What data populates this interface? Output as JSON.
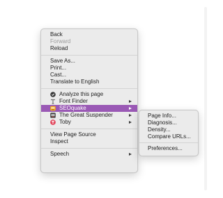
{
  "colors": {
    "menu_bg": "#ebebeb",
    "highlight": "#9a59b5",
    "disabled_text": "#9b9b9b"
  },
  "context_menu": {
    "back": "Back",
    "forward": "Forward",
    "reload": "Reload",
    "save_as": "Save As...",
    "print": "Print...",
    "cast": "Cast...",
    "translate": "Translate to English",
    "analyze": "Analyze this page",
    "font_finder": "Font Finder",
    "seoquake": "SEOquake",
    "great_suspender": "The Great Suspender",
    "toby": "Toby",
    "view_source": "View Page Source",
    "inspect": "Inspect",
    "speech": "Speech"
  },
  "icons": {
    "analyze": "analyze-extension-icon",
    "font_finder": "font-finder-icon",
    "seoquake": "seoquake-icon",
    "great_suspender": "great-suspender-icon",
    "toby": "toby-icon",
    "submenu_arrow": "chevron-right-icon"
  },
  "seoquake_submenu": {
    "page_info": "Page Info...",
    "diagnosis": "Diagnosis...",
    "density": "Density...",
    "compare_urls": "Compare URLs...",
    "preferences": "Preferences..."
  }
}
